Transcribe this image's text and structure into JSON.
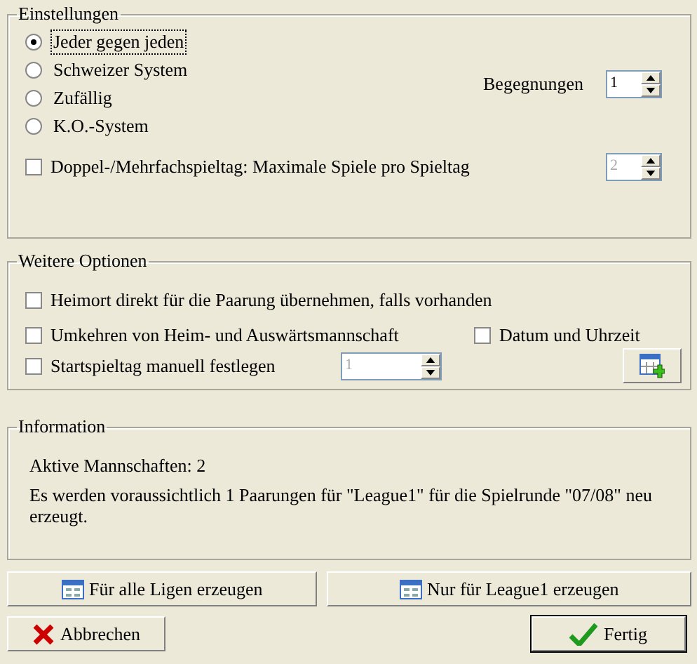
{
  "settings": {
    "title": "Einstellungen",
    "modes": [
      {
        "label": "Jeder gegen jeden",
        "selected": true,
        "focused": true
      },
      {
        "label": "Schweizer System",
        "selected": false,
        "focused": false
      },
      {
        "label": "Zufällig",
        "selected": false,
        "focused": false
      },
      {
        "label": "K.O.-System",
        "selected": false,
        "focused": false
      }
    ],
    "encounters": {
      "label": "Begegnungen",
      "value": "1",
      "disabled": false
    },
    "multi_matchday": {
      "label": "Doppel-/Mehrfachspieltag: Maximale Spiele pro Spieltag",
      "checked": false,
      "value": "2",
      "disabled": true
    }
  },
  "options": {
    "title": "Weitere Optionen",
    "home_venue": {
      "label": "Heimort direkt für die Paarung übernehmen, falls vorhanden",
      "checked": false
    },
    "swap": {
      "label": "Umkehren von Heim- und Auswärtsmannschaft",
      "checked": false
    },
    "date_time": {
      "label": "Datum und Uhrzeit",
      "checked": false
    },
    "start_matchday": {
      "label": "Startspieltag manuell festlegen",
      "checked": false,
      "value": "1",
      "disabled": true
    }
  },
  "information": {
    "title": "Information",
    "lines": [
      "Aktive Mannschaften: 2",
      "Es werden voraussichtlich 1 Paarungen für \"League1\" für die Spielrunde \"07/08\" neu erzeugt."
    ]
  },
  "generate_buttons": [
    "Für alle Ligen erzeugen",
    "Nur für League1 erzeugen"
  ],
  "cancel_button": "Abbrechen",
  "done_button": {
    "label": "Fertig",
    "default": true
  }
}
